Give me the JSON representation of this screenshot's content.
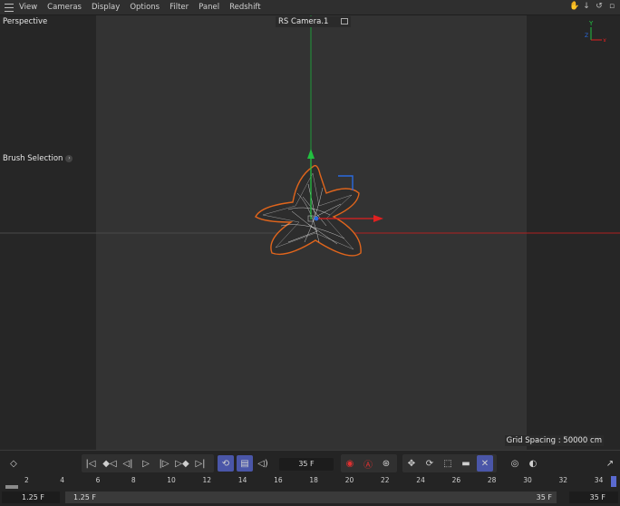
{
  "menu": {
    "items": [
      "View",
      "Cameras",
      "Display",
      "Options",
      "Filter",
      "Panel",
      "Redshift"
    ]
  },
  "viewport": {
    "name": "Perspective",
    "camera": "RS Camera.1",
    "tool_label": "Brush Selection",
    "grid_spacing": "Grid Spacing : 50000 cm",
    "axis_labels": {
      "y": "Y",
      "z": "Z",
      "x": "X"
    }
  },
  "timeline": {
    "current_frame": "35 F",
    "ruler_ticks": [
      "2",
      "4",
      "6",
      "8",
      "10",
      "12",
      "14",
      "16",
      "18",
      "20",
      "22",
      "24",
      "26",
      "28",
      "30",
      "32",
      "34"
    ],
    "min_time": "1.25 F",
    "range_start": "1.25 F",
    "range_end": "35 F",
    "max_time": "35 F"
  },
  "colors": {
    "accent": "#4a56a8",
    "axis_x": "#e02020",
    "axis_y": "#20c040",
    "axis_z": "#2a6ae0",
    "selection_outline": "#e0651c"
  }
}
